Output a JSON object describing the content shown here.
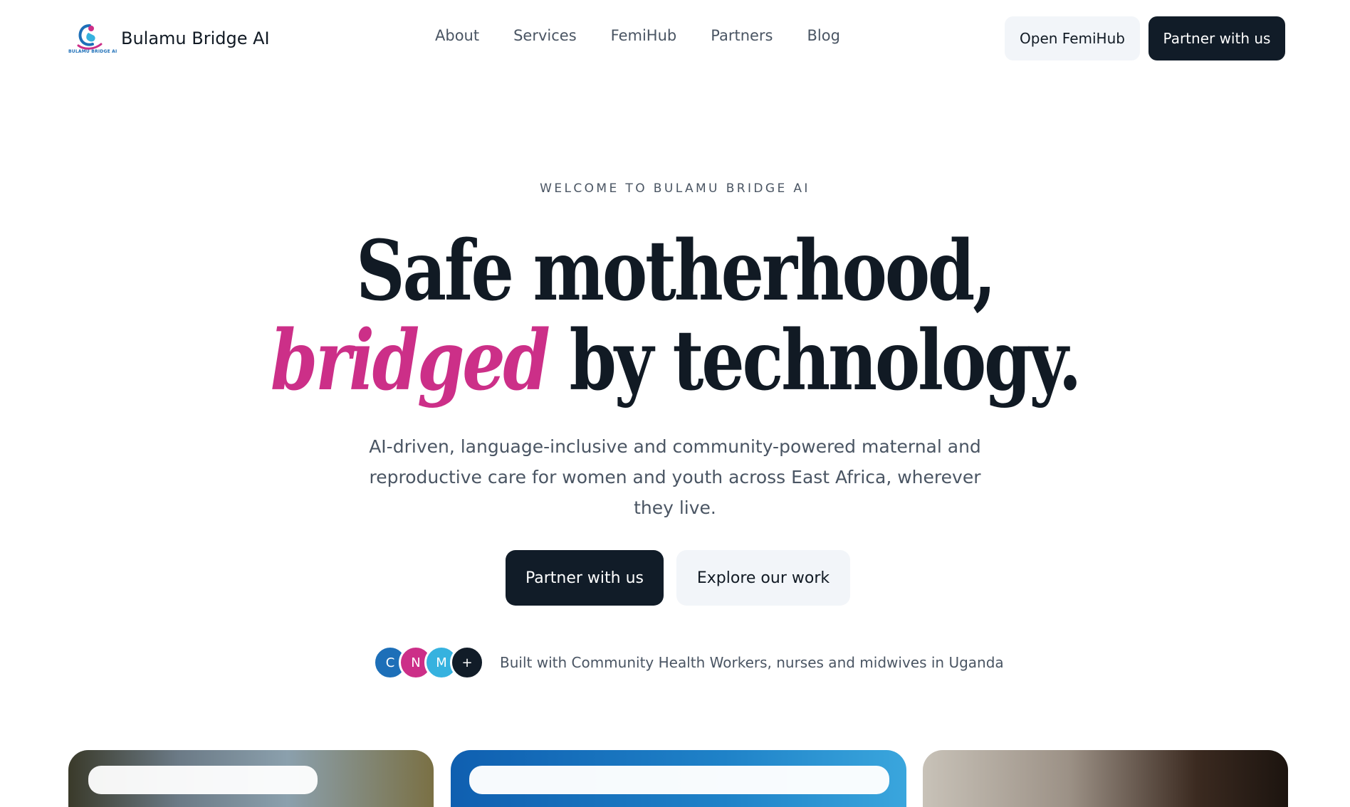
{
  "brand": {
    "name": "Bulamu Bridge AI",
    "logo_text": "BULAMU BRIDGE AI"
  },
  "nav": {
    "links": [
      "About",
      "Services",
      "FemiHub",
      "Partners",
      "Blog"
    ],
    "open_femihub": "Open FemiHub",
    "partner": "Partner with us"
  },
  "hero": {
    "eyebrow": "WELCOME TO BULAMU BRIDGE AI",
    "headline_line1": "Safe motherhood,",
    "headline_accent": "bridged",
    "headline_line2_rest": " by technology.",
    "subtext": "AI-driven, language-inclusive and community-powered maternal and reproductive care for women and youth across East Africa, wherever they live.",
    "cta_primary": "Partner with us",
    "cta_secondary": "Explore our work",
    "trust_text": "Built with Community Health Workers, nurses and midwives in Uganda",
    "avatars": [
      {
        "initial": "C",
        "color": "#1d6fb8"
      },
      {
        "initial": "N",
        "color": "#cc2f88"
      },
      {
        "initial": "M",
        "color": "#36b2df"
      },
      {
        "initial": "+",
        "color": "#111c28"
      }
    ]
  },
  "colors": {
    "accent": "#cc2f88",
    "dark": "#111c28",
    "light_button": "#f2f5f9",
    "muted_text": "#4a5563"
  },
  "icons": {
    "logo": "mother-and-child-logo-icon"
  }
}
